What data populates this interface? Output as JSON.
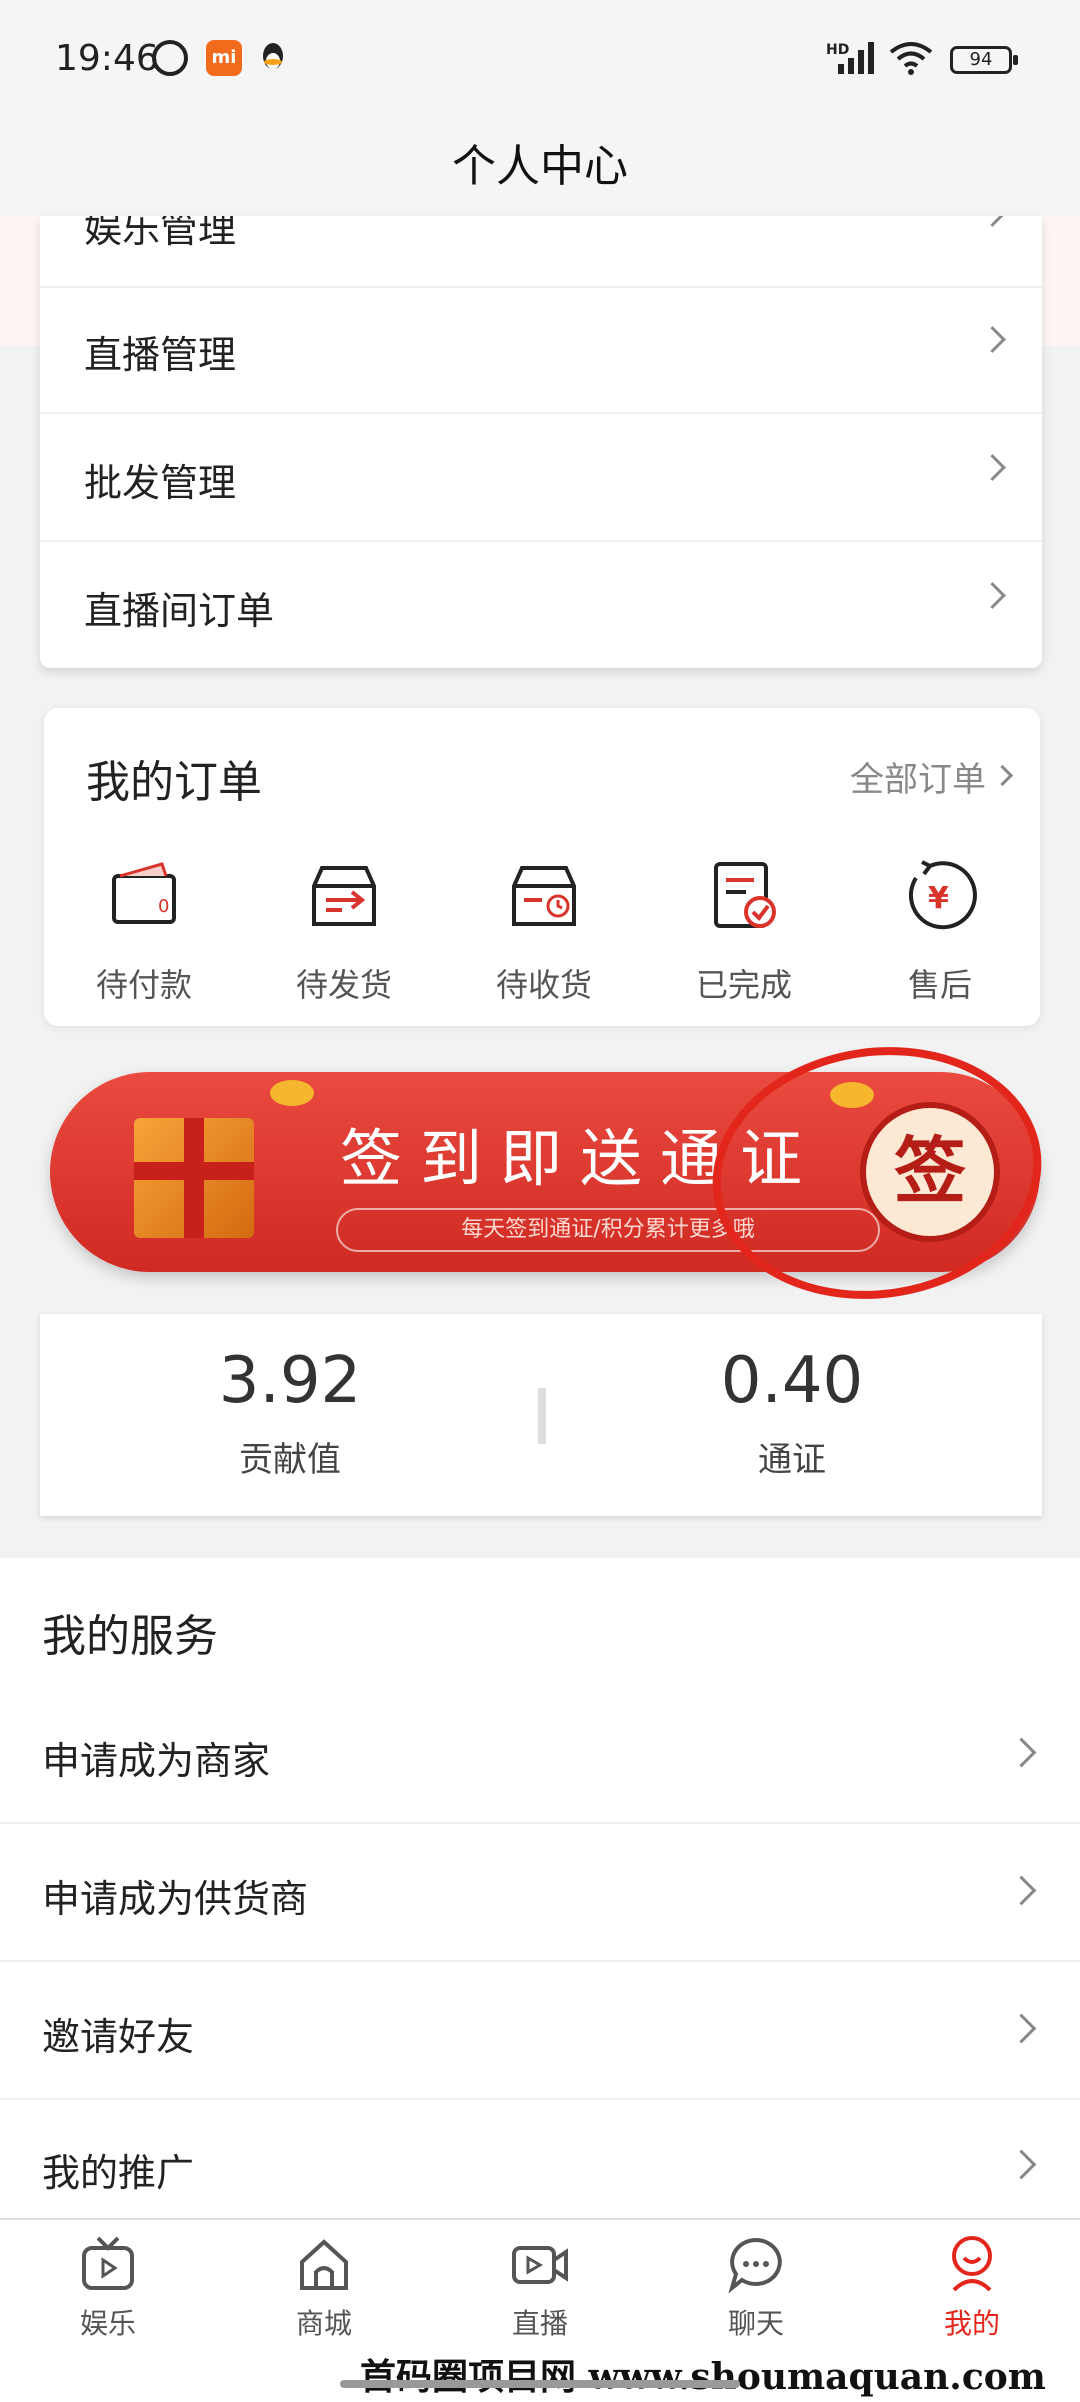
{
  "status_bar": {
    "time": "19:46",
    "battery": "94",
    "network": "HD"
  },
  "header": {
    "title": "个人中心"
  },
  "menu": {
    "items": [
      {
        "label": "娱乐管理"
      },
      {
        "label": "直播管理"
      },
      {
        "label": "批发管理"
      },
      {
        "label": "直播间订单"
      }
    ]
  },
  "orders": {
    "title": "我的订单",
    "all_label": "全部订单",
    "items": [
      {
        "label": "待付款",
        "icon": "wallet-icon"
      },
      {
        "label": "待发货",
        "icon": "box-send-icon"
      },
      {
        "label": "待收货",
        "icon": "box-clock-icon"
      },
      {
        "label": "已完成",
        "icon": "document-check-icon"
      },
      {
        "label": "售后",
        "icon": "yen-refresh-icon"
      }
    ]
  },
  "banner": {
    "title": "签到即送通证",
    "subtitle": "每天签到通证/积分累计更多哦",
    "sign_label": "签"
  },
  "stats": {
    "left": {
      "value": "3.92",
      "label": "贡献值"
    },
    "right": {
      "value": "0.40",
      "label": "通证"
    }
  },
  "services": {
    "title": "我的服务",
    "items": [
      {
        "label": "申请成为商家"
      },
      {
        "label": "申请成为供货商"
      },
      {
        "label": "邀请好友"
      },
      {
        "label": "我的推广"
      }
    ]
  },
  "tabbar": {
    "items": [
      {
        "label": "娱乐",
        "icon": "tv-icon"
      },
      {
        "label": "商城",
        "icon": "home-icon"
      },
      {
        "label": "直播",
        "icon": "video-icon"
      },
      {
        "label": "聊天",
        "icon": "chat-icon"
      },
      {
        "label": "我的",
        "icon": "smile-user-icon",
        "active": true
      }
    ]
  },
  "watermark": "首码圈项目网 www.shoumaquan.com",
  "colors": {
    "accent": "#e3261c",
    "banner": "#d9342c"
  }
}
